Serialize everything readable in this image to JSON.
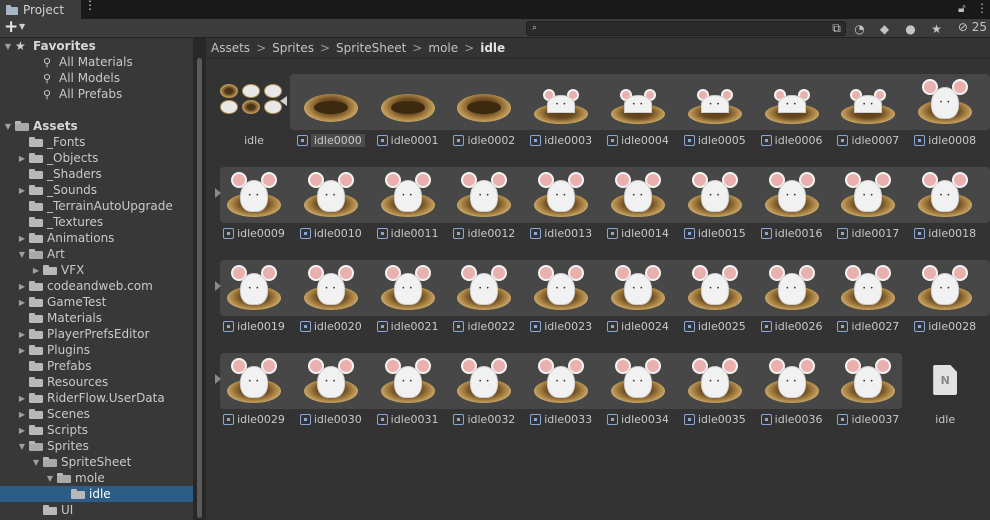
{
  "tab": {
    "title": "Project"
  },
  "toolbar": {
    "create": "+",
    "hidden_count": "25"
  },
  "tree": [
    {
      "label": "Favorites",
      "indent": 0,
      "arrow": "open",
      "icon": "star",
      "bold": true
    },
    {
      "label": "All Materials",
      "indent": 2,
      "icon": "search"
    },
    {
      "label": "All Models",
      "indent": 2,
      "icon": "search"
    },
    {
      "label": "All Prefabs",
      "indent": 2,
      "icon": "search"
    },
    {
      "label": "",
      "indent": 0,
      "icon": "none"
    },
    {
      "label": "Assets",
      "indent": 0,
      "arrow": "open",
      "icon": "folder-open",
      "bold": true
    },
    {
      "label": "_Fonts",
      "indent": 1,
      "icon": "folder"
    },
    {
      "label": "_Objects",
      "indent": 1,
      "arrow": "closed",
      "icon": "folder"
    },
    {
      "label": "_Shaders",
      "indent": 1,
      "icon": "folder"
    },
    {
      "label": "_Sounds",
      "indent": 1,
      "arrow": "closed",
      "icon": "folder"
    },
    {
      "label": "_TerrainAutoUpgrade",
      "indent": 1,
      "icon": "folder"
    },
    {
      "label": "_Textures",
      "indent": 1,
      "icon": "folder"
    },
    {
      "label": "Animations",
      "indent": 1,
      "arrow": "closed",
      "icon": "folder"
    },
    {
      "label": "Art",
      "indent": 1,
      "arrow": "open",
      "icon": "folder-open"
    },
    {
      "label": "VFX",
      "indent": 2,
      "arrow": "closed",
      "icon": "folder"
    },
    {
      "label": "codeandweb.com",
      "indent": 1,
      "arrow": "closed",
      "icon": "folder"
    },
    {
      "label": "GameTest",
      "indent": 1,
      "arrow": "closed",
      "icon": "folder"
    },
    {
      "label": "Materials",
      "indent": 1,
      "icon": "folder"
    },
    {
      "label": "PlayerPrefsEditor",
      "indent": 1,
      "arrow": "closed",
      "icon": "folder"
    },
    {
      "label": "Plugins",
      "indent": 1,
      "arrow": "closed",
      "icon": "folder"
    },
    {
      "label": "Prefabs",
      "indent": 1,
      "icon": "folder"
    },
    {
      "label": "Resources",
      "indent": 1,
      "icon": "folder"
    },
    {
      "label": "RiderFlow.UserData",
      "indent": 1,
      "arrow": "closed",
      "icon": "folder"
    },
    {
      "label": "Scenes",
      "indent": 1,
      "arrow": "closed",
      "icon": "folder"
    },
    {
      "label": "Scripts",
      "indent": 1,
      "arrow": "closed",
      "icon": "folder"
    },
    {
      "label": "Sprites",
      "indent": 1,
      "arrow": "open",
      "icon": "folder-open"
    },
    {
      "label": "SpriteSheet",
      "indent": 2,
      "arrow": "open",
      "icon": "folder-open"
    },
    {
      "label": "mole",
      "indent": 3,
      "arrow": "open",
      "icon": "folder-open"
    },
    {
      "label": "idle",
      "indent": 4,
      "icon": "folder",
      "selected": true
    },
    {
      "label": "UI",
      "indent": 2,
      "icon": "folder"
    }
  ],
  "breadcrumb": [
    "Assets",
    "Sprites",
    "SpriteSheet",
    "mole",
    "idle"
  ],
  "atlas": {
    "label": "idle"
  },
  "sprites": [
    {
      "label": "idle0000",
      "kind": "empty",
      "selected": true
    },
    {
      "label": "idle0001",
      "kind": "empty"
    },
    {
      "label": "idle0002",
      "kind": "empty"
    },
    {
      "label": "idle0003",
      "kind": "peek"
    },
    {
      "label": "idle0004",
      "kind": "peek"
    },
    {
      "label": "idle0005",
      "kind": "peek"
    },
    {
      "label": "idle0006",
      "kind": "peek"
    },
    {
      "label": "idle0007",
      "kind": "peek"
    },
    {
      "label": "idle0008",
      "kind": "full"
    },
    {
      "label": "idle0009",
      "kind": "full"
    },
    {
      "label": "idle0010",
      "kind": "full"
    },
    {
      "label": "idle0011",
      "kind": "full"
    },
    {
      "label": "idle0012",
      "kind": "full"
    },
    {
      "label": "idle0013",
      "kind": "full"
    },
    {
      "label": "idle0014",
      "kind": "full"
    },
    {
      "label": "idle0015",
      "kind": "full"
    },
    {
      "label": "idle0016",
      "kind": "full"
    },
    {
      "label": "idle0017",
      "kind": "full"
    },
    {
      "label": "idle0018",
      "kind": "full"
    },
    {
      "label": "idle0019",
      "kind": "full"
    },
    {
      "label": "idle0020",
      "kind": "full"
    },
    {
      "label": "idle0021",
      "kind": "full"
    },
    {
      "label": "idle0022",
      "kind": "full"
    },
    {
      "label": "idle0023",
      "kind": "full"
    },
    {
      "label": "idle0024",
      "kind": "full"
    },
    {
      "label": "idle0025",
      "kind": "full"
    },
    {
      "label": "idle0026",
      "kind": "full"
    },
    {
      "label": "idle0027",
      "kind": "full"
    },
    {
      "label": "idle0028",
      "kind": "full"
    },
    {
      "label": "idle0029",
      "kind": "full"
    },
    {
      "label": "idle0030",
      "kind": "full"
    },
    {
      "label": "idle0031",
      "kind": "full"
    },
    {
      "label": "idle0032",
      "kind": "full"
    },
    {
      "label": "idle0033",
      "kind": "full"
    },
    {
      "label": "idle0034",
      "kind": "full"
    },
    {
      "label": "idle0035",
      "kind": "full"
    },
    {
      "label": "idle0036",
      "kind": "full"
    },
    {
      "label": "idle0037",
      "kind": "full"
    }
  ],
  "anim_file": {
    "label": "idle",
    "glyph": "N"
  }
}
